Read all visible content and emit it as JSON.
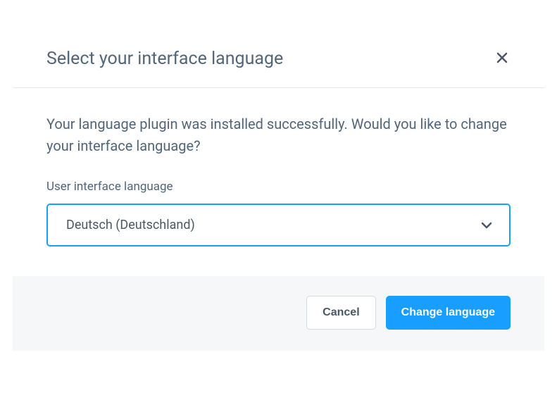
{
  "dialog": {
    "title": "Select your interface language",
    "message": "Your language plugin was installed successfully. Would you like to change your interface language?",
    "field_label": "User interface language",
    "selected_value": "Deutsch (Deutschland)",
    "cancel_label": "Cancel",
    "confirm_label": "Change language"
  }
}
